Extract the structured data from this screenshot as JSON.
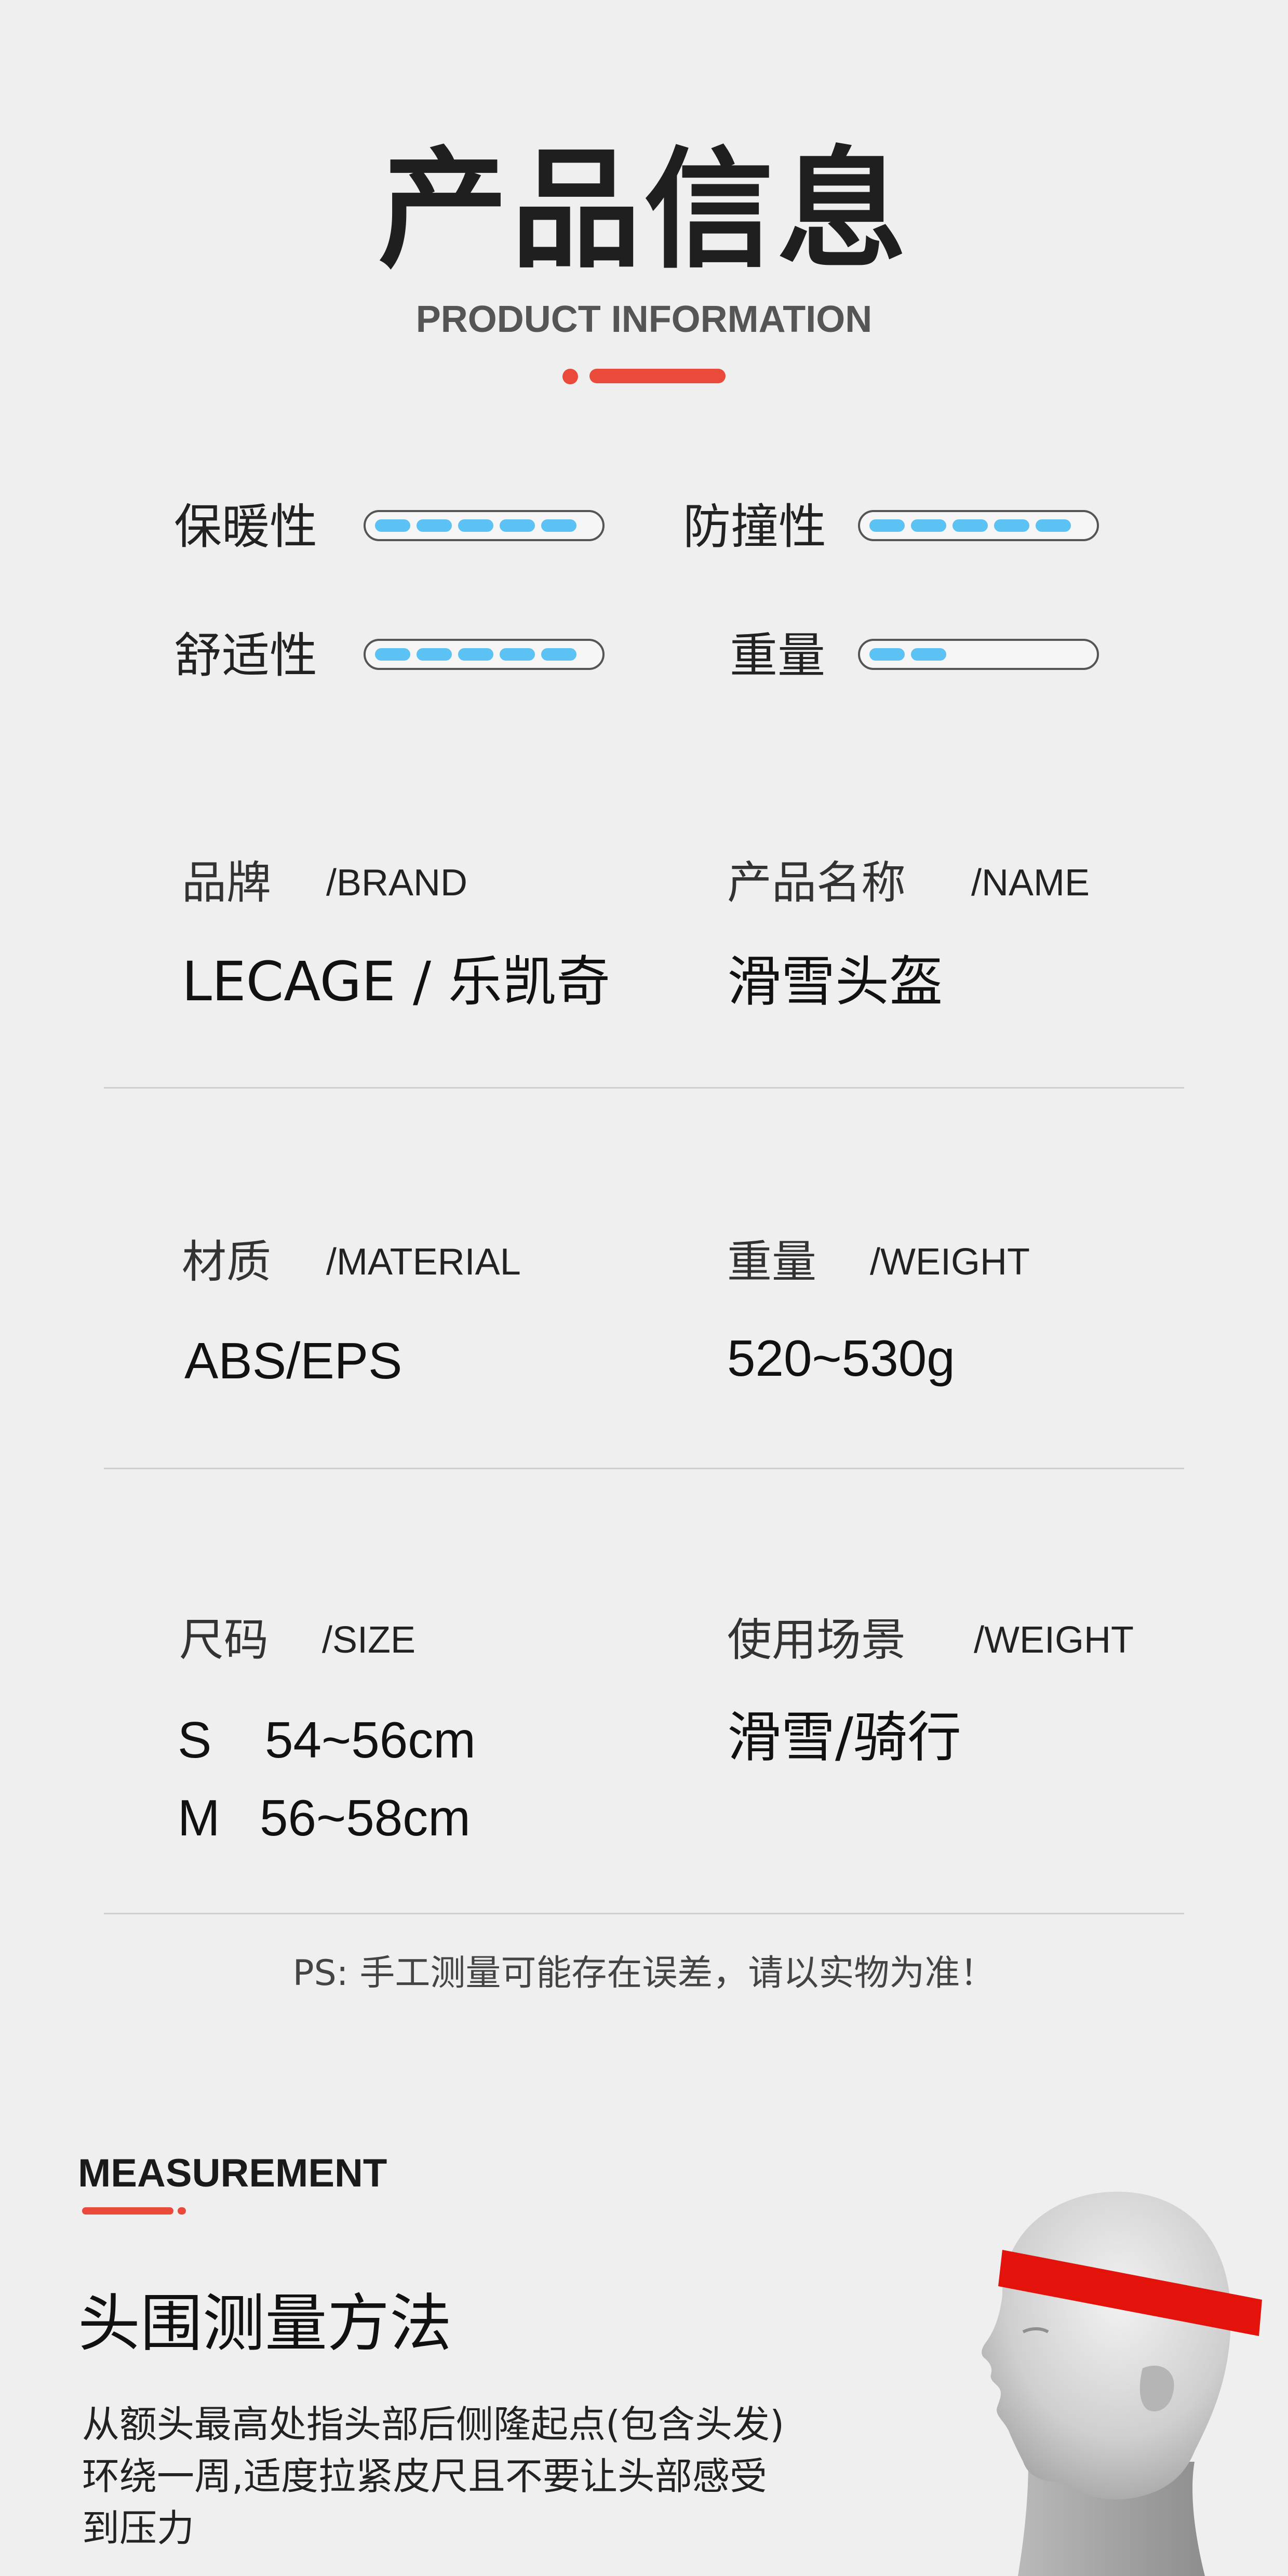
{
  "header": {
    "title_cn": "产品信息",
    "title_en": "PRODUCT INFORMATION",
    "accent_color": "#e94a3a"
  },
  "ratings": {
    "max_segments": 5,
    "segment_color": "#5cc2f4",
    "items": [
      {
        "label": "保暖性",
        "level": 5
      },
      {
        "label": "防撞性",
        "level": 5
      },
      {
        "label": "舒适性",
        "level": 5
      },
      {
        "label": "重量",
        "level": 2
      }
    ]
  },
  "specs": {
    "brand": {
      "label_cn": "品牌",
      "label_en": "/BRAND",
      "value": "LECAGE / 乐凯奇"
    },
    "name": {
      "label_cn": "产品名称",
      "label_en": "/NAME",
      "value": "滑雪头盔"
    },
    "material": {
      "label_cn": "材质",
      "label_en": "/MATERIAL",
      "value": "ABS/EPS"
    },
    "weight": {
      "label_cn": "重量",
      "label_en": "/WEIGHT",
      "value": "520~530g"
    },
    "size": {
      "label_cn": "尺码",
      "label_en": "/SIZE",
      "values": [
        {
          "size": "S",
          "range": "54~56cm"
        },
        {
          "size": "M",
          "range": "56~58cm"
        }
      ]
    },
    "scene": {
      "label_cn": "使用场景",
      "label_en": "/WEIGHT",
      "value": "滑雪/骑行"
    }
  },
  "note": "PS: 手工测量可能存在误差，请以实物为准！",
  "measurement": {
    "heading_en": "MEASUREMENT",
    "title": "头围测量方法",
    "desc_lines": [
      "从额头最高处指头部后侧隆起点(包含头发)",
      "环绕一周,适度拉紧皮尺且不要让头部感受",
      "到压力"
    ],
    "tape_color": "#e3120b"
  }
}
